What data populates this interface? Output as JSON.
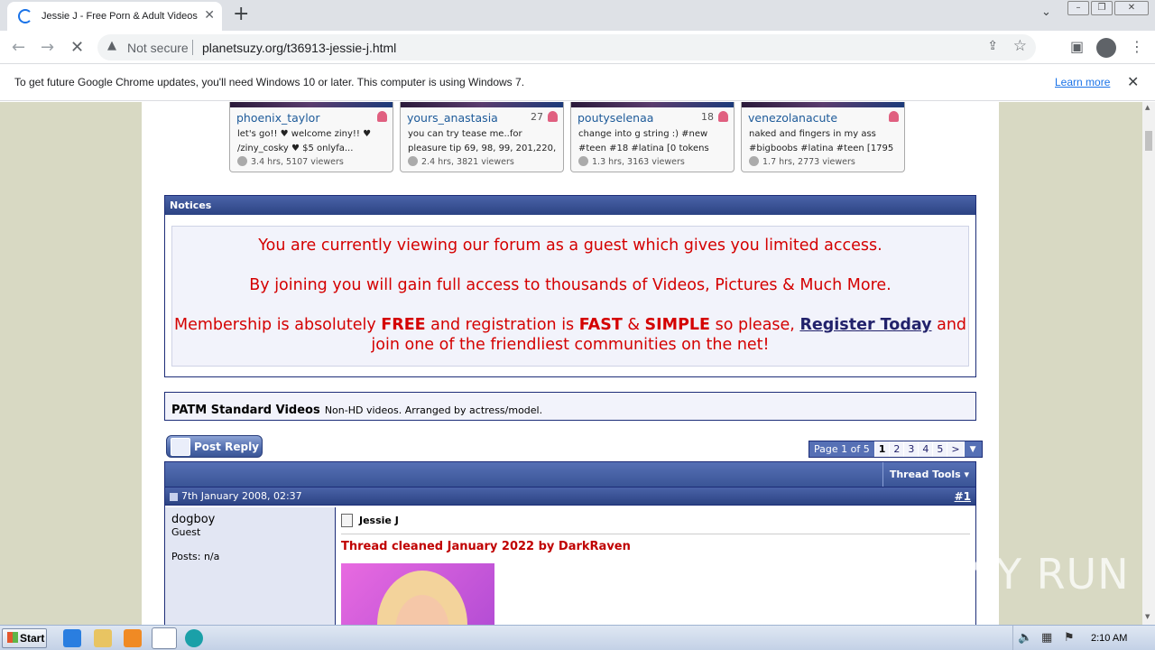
{
  "browser": {
    "tab_title": "Jessie J - Free Porn & Adult Videos F",
    "new_tab": "+",
    "security_label": "Not secure",
    "url": "planetsuzy.org/t36913-jessie-j.html"
  },
  "infobar": {
    "message": "To get future Google Chrome updates, you'll need Windows 10 or later. This computer is using Windows 7.",
    "link": "Learn more"
  },
  "cams": [
    {
      "name": "phoenix_taylor",
      "count": "",
      "desc1": "let's go!! ♥ welcome ziny!! ♥",
      "desc2": "/ziny_cosky ♥ $5 onlyfa...",
      "stats": "3.4 hrs, 5107 viewers"
    },
    {
      "name": "yours_anastasia",
      "count": "27",
      "desc1": "you can try tease me..for",
      "desc2": "pleasure tip 69, 98, 99, 201,220,",
      "stats": "2.4 hrs, 3821 viewers"
    },
    {
      "name": "poutyselenaa",
      "count": "18",
      "desc1": "change into g string :) #new",
      "desc2": "#teen #18 #latina [0 tokens",
      "stats": "1.3 hrs, 3163 viewers"
    },
    {
      "name": "venezolanacute",
      "count": "",
      "desc1": "naked and fingers in my ass",
      "desc2": "#bigboobs #latina #teen [1795",
      "stats": "1.7 hrs, 2773 viewers"
    }
  ],
  "notices": {
    "header": "Notices",
    "line1": "You are currently viewing our forum as a guest which gives you limited access.",
    "line2": "By joining you will gain full access to thousands of Videos, Pictures & Much More.",
    "line3_a": "Membership is absolutely ",
    "line3_free": "FREE",
    "line3_b": " and registration is ",
    "line3_fast": "FAST",
    "line3_amp": " & ",
    "line3_simple": "SIMPLE",
    "line3_c": " so please, ",
    "register_link": "Register Today",
    "line3_d": " and join one of the friendliest communities on the net!"
  },
  "forum": {
    "name": "PATM Standard Videos",
    "desc": "Non-HD videos. Arranged by actress/model."
  },
  "buttons": {
    "post_reply": "Post Reply"
  },
  "pager": {
    "label": "Page 1 of 5",
    "pages": [
      "1",
      "2",
      "3",
      "4",
      "5"
    ],
    "next": ">",
    "drop": "▼"
  },
  "thread": {
    "tools": "Thread Tools ▾",
    "date": "7th January 2008, 02:37",
    "post_number": "#1",
    "username": "dogboy",
    "user_role": "Guest",
    "posts": "Posts: n/a",
    "title": "Jessie J",
    "cleaned": "Thread cleaned January 2022 by DarkRaven"
  },
  "watermark": "ANY RUN",
  "taskbar": {
    "start": "Start",
    "time": "2:10 AM"
  }
}
